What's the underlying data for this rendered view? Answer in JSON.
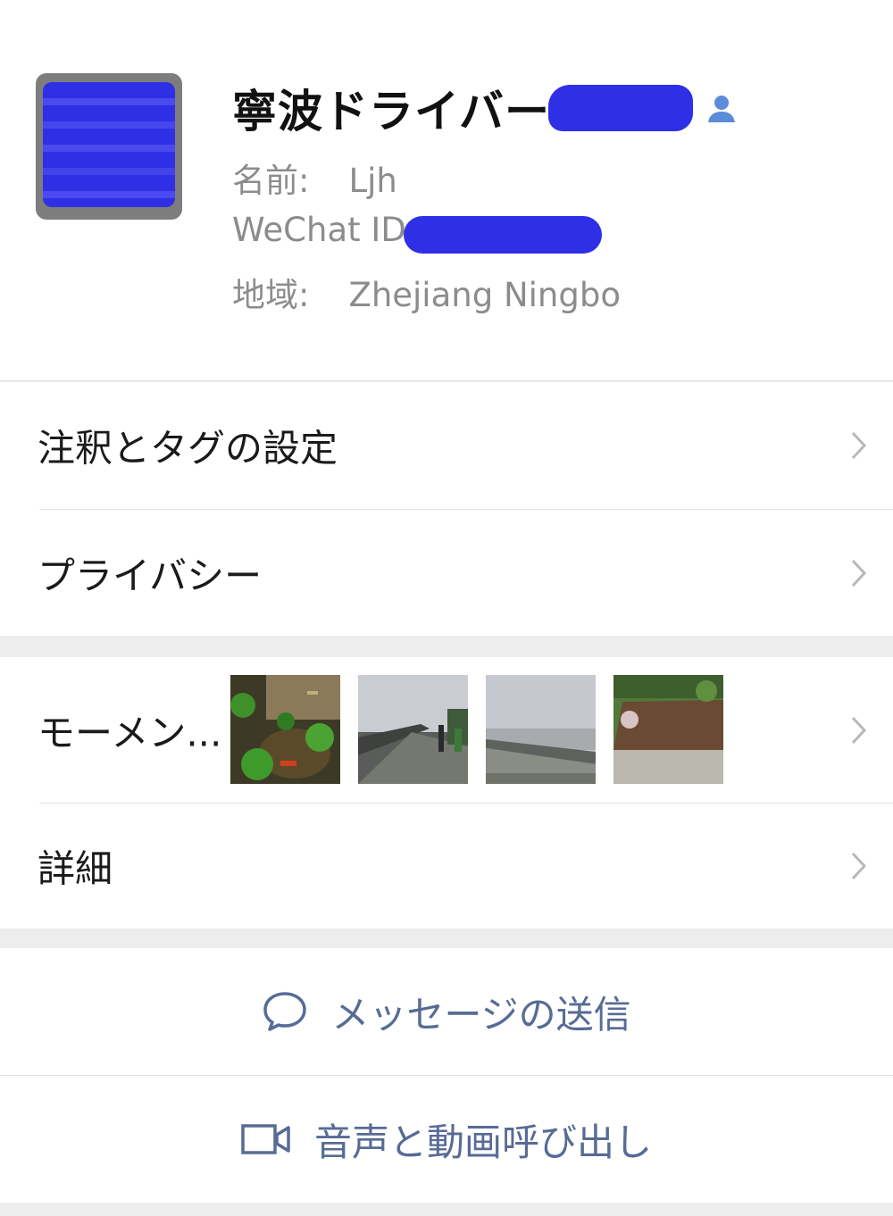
{
  "profile": {
    "nickname": "寧波ドライバー",
    "name_label": "名前:",
    "name_value": "Ljh",
    "wechat_id_label": "WeChat ID:",
    "region_label": "地域:",
    "region_value": "Zhejiang  Ningbo"
  },
  "menu": {
    "remarks_tags": "注釈とタグの設定",
    "privacy": "プライバシー",
    "moments": "モーメン...",
    "details": "詳細"
  },
  "actions": {
    "send_message": "メッセージの送信",
    "voice_video_call": "音声と動画呼び出し"
  },
  "colors": {
    "link_blue": "#576b95",
    "redaction_blue": "#2f2fe6",
    "contact_icon_blue": "#5b8bd9"
  },
  "icons": [
    "contact-icon",
    "chevron-right-icon",
    "chat-bubble-icon",
    "video-camera-icon"
  ]
}
